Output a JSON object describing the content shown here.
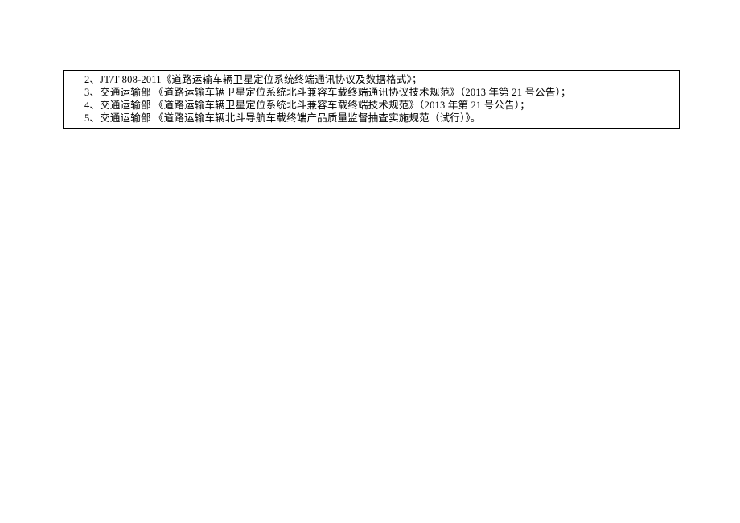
{
  "lines": [
    {
      "num": "2、",
      "text": "JT/T 808-2011《道路运输车辆卫星定位系统终端通讯协议及数据格式》；"
    },
    {
      "num": "3、",
      "text": "交通运输部 《道路运输车辆卫星定位系统北斗兼容车载终端通讯协议技术规范》（2013 年第 21 号公告）；"
    },
    {
      "num": "4、",
      "text": "交通运输部 《道路运输车辆卫星定位系统北斗兼容车载终端技术规范》（2013 年第 21 号公告）；"
    },
    {
      "num": "5、",
      "text": "交通运输部 《道路运输车辆北斗导航车载终端产品质量监督抽查实施规范（试行）》。"
    }
  ]
}
